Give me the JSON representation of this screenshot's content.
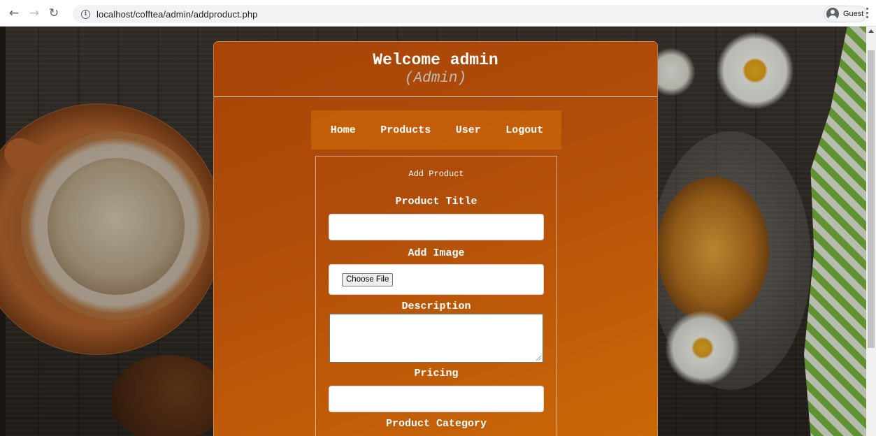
{
  "browser": {
    "back_icon": "arrow-left-icon",
    "forward_icon": "arrow-right-icon",
    "reload_icon": "reload-icon",
    "url": "localhost/cofftea/admin/addproduct.php",
    "profile_label": "Guest"
  },
  "header": {
    "welcome": "Welcome admin",
    "role": "(Admin)"
  },
  "menu": {
    "home": "Home",
    "products": "Products",
    "user": "User",
    "logout": "Logout"
  },
  "form": {
    "heading": "Add Product",
    "title_label": "Product Title",
    "title_value": "",
    "image_label": "Add Image",
    "file_button": "Choose File",
    "description_label": "Description",
    "description_value": "",
    "pricing_label": "Pricing",
    "pricing_value": "",
    "category_label": "Product Category"
  },
  "colors": {
    "panel_top": "#a84406",
    "panel_bottom": "#cb6806",
    "menu_bg": "#d76e0a"
  }
}
